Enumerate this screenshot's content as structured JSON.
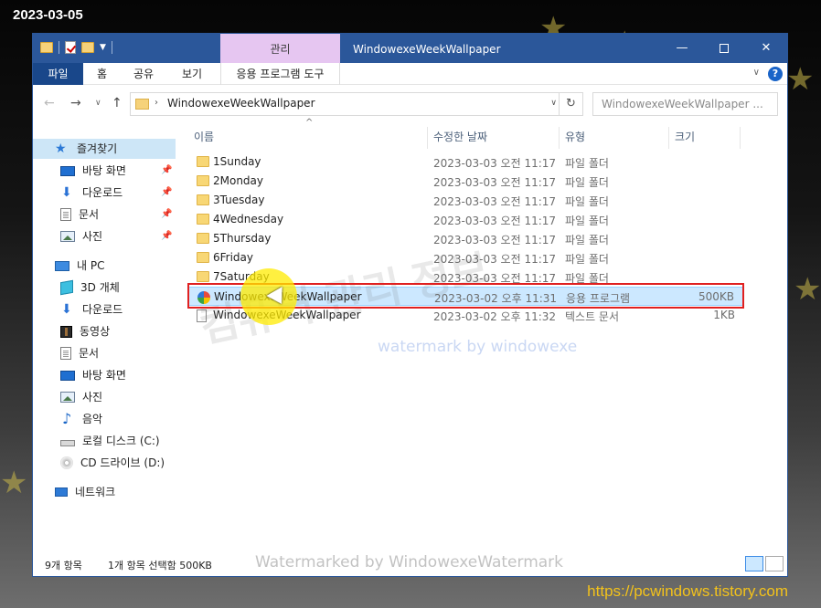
{
  "overlay": {
    "date": "2023-03-05",
    "site_url": "https://pcwindows.tistory.com",
    "watermark_ko": "컴퓨터 관리 정보",
    "watermark_en": "watermark by windowexe",
    "status_watermark": "Watermarked by WindowexeWatermark"
  },
  "window": {
    "title": "WindowexeWeekWallpaper",
    "manage_tab": "관리",
    "ribbon_tabs": {
      "file": "파일",
      "home": "홈",
      "share": "공유",
      "view": "보기",
      "app_tools": "응용 프로그램 도구"
    }
  },
  "address": {
    "path": "WindowexeWeekWallpaper",
    "search_placeholder": "WindowexeWeekWallpaper ..."
  },
  "sidebar": {
    "quick_access": "즐겨찾기",
    "quick_items": [
      "바탕 화면",
      "다운로드",
      "문서",
      "사진"
    ],
    "this_pc": "내 PC",
    "pc_items": [
      "3D 개체",
      "다운로드",
      "동영상",
      "문서",
      "바탕 화면",
      "사진",
      "음악",
      "로컬 디스크 (C:)",
      "CD 드라이브 (D:)"
    ],
    "network": "네트워크"
  },
  "columns": {
    "name": "이름",
    "date": "수정한 날짜",
    "type": "유형",
    "size": "크기"
  },
  "files": [
    {
      "name": "1Sunday",
      "date": "2023-03-03 오전 11:17",
      "type": "파일 폴더",
      "size": "",
      "kind": "folder"
    },
    {
      "name": "2Monday",
      "date": "2023-03-03 오전 11:17",
      "type": "파일 폴더",
      "size": "",
      "kind": "folder"
    },
    {
      "name": "3Tuesday",
      "date": "2023-03-03 오전 11:17",
      "type": "파일 폴더",
      "size": "",
      "kind": "folder"
    },
    {
      "name": "4Wednesday",
      "date": "2023-03-03 오전 11:17",
      "type": "파일 폴더",
      "size": "",
      "kind": "folder"
    },
    {
      "name": "5Thursday",
      "date": "2023-03-03 오전 11:17",
      "type": "파일 폴더",
      "size": "",
      "kind": "folder"
    },
    {
      "name": "6Friday",
      "date": "2023-03-03 오전 11:17",
      "type": "파일 폴더",
      "size": "",
      "kind": "folder"
    },
    {
      "name": "7Saturday",
      "date": "2023-03-03 오전 11:17",
      "type": "파일 폴더",
      "size": "",
      "kind": "folder"
    },
    {
      "name": "WindowexeWeekWallpaper",
      "date": "2023-03-02 오후 11:31",
      "type": "응용 프로그램",
      "size": "500KB",
      "kind": "app"
    },
    {
      "name": "WindowexeWeekWallpaper",
      "date": "2023-03-02 오후 11:32",
      "type": "텍스트 문서",
      "size": "1KB",
      "kind": "text"
    }
  ],
  "status": {
    "item_count": "9개 항목",
    "selection": "1개 항목 선택함 500KB"
  }
}
